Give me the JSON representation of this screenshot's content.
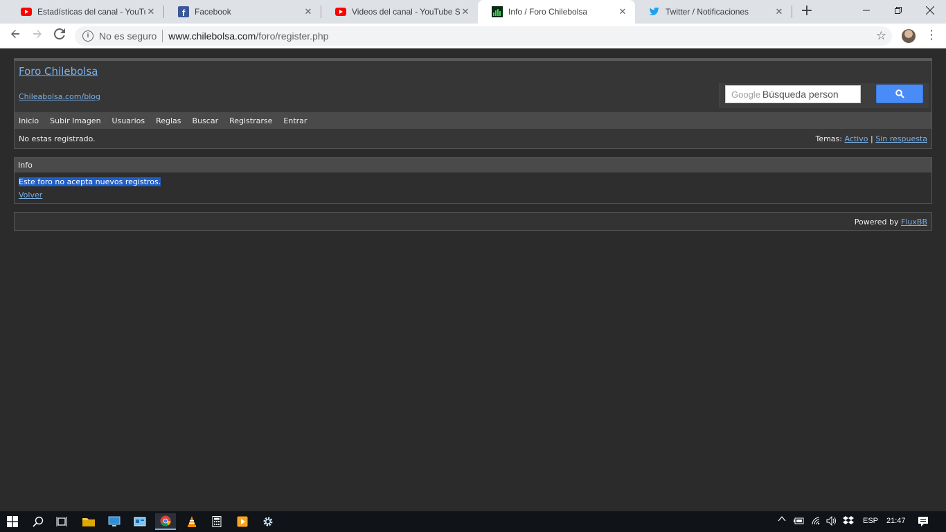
{
  "browser": {
    "tabs": [
      {
        "title": "Estadísticas del canal - YouTub",
        "favicon": "youtube-icon",
        "active": false
      },
      {
        "title": "Facebook",
        "favicon": "facebook-icon",
        "active": false
      },
      {
        "title": "Videos del canal - YouTube Stu",
        "favicon": "youtube-icon",
        "active": false
      },
      {
        "title": "Info / Foro Chilebolsa",
        "favicon": "chilebolsa-icon",
        "active": true
      },
      {
        "title": "Twitter / Notificaciones",
        "favicon": "twitter-icon",
        "active": false
      }
    ],
    "close_glyph": "✕",
    "new_tab_glyph": "+",
    "security_label": "No es seguro",
    "url_host": "www.chilebolsa.com",
    "url_path": "/foro/register.php"
  },
  "forum": {
    "title": "Foro Chilebolsa",
    "description": "Chileabolsa.com/blog",
    "search_brand": "Google",
    "search_placeholder": "Búsqueda person",
    "nav": [
      "Inicio",
      "Subir Imagen",
      "Usuarios",
      "Reglas",
      "Buscar",
      "Registrarse",
      "Entrar"
    ],
    "status": "No estas registrado.",
    "topics_label": "Temas:",
    "topics_active": "Activo",
    "topics_separator": "|",
    "topics_unanswered": "Sin respuesta"
  },
  "info": {
    "heading": "Info",
    "message": "Este foro no acepta nuevos registros.",
    "back": "Volver"
  },
  "footer": {
    "powered_by": "Powered by",
    "link": "FluxBB"
  },
  "taskbar": {
    "language": "ESP",
    "time": "21:47"
  },
  "colors": {
    "page_bg": "#2b2b2b",
    "link": "#7ab0e8",
    "selection": "#1e5fc8",
    "search_button": "#4a8cf7"
  }
}
